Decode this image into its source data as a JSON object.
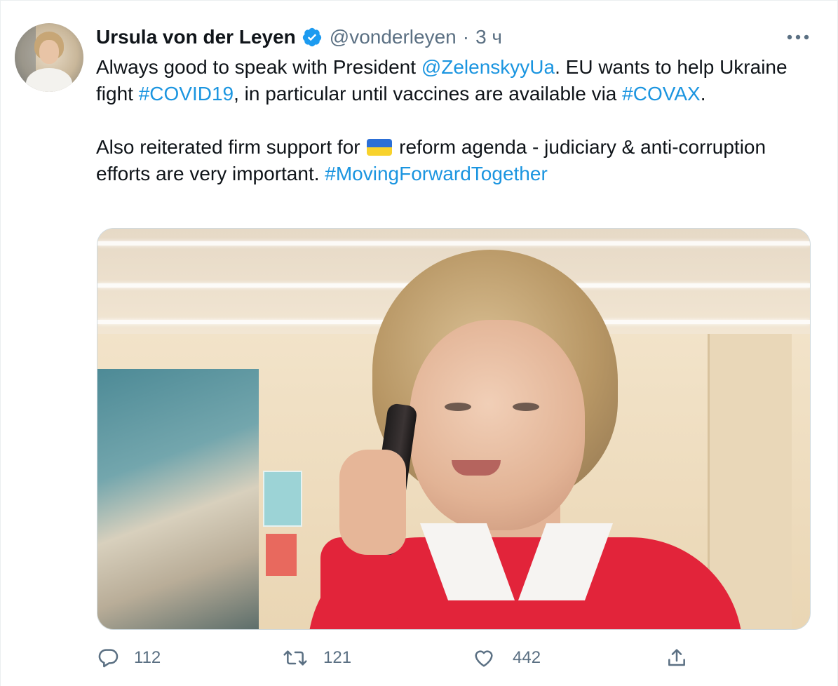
{
  "author": {
    "name": "Ursula von der Leyen",
    "handle": "@vonderleyen",
    "separator": "·",
    "time": "3 ч",
    "verified_icon": "verified-badge-icon"
  },
  "tweet": {
    "line1_a": "Always good to speak with President ",
    "mention": "@ZelenskyyUa",
    "line1_b": ". EU wants to help Ukraine fight ",
    "hashtag1": "#COVID19",
    "line1_c": ", in particular until vaccines are available via ",
    "hashtag2": "#COVAX",
    "line1_d": ".",
    "line2_a": "Also reiterated firm support for ",
    "flag_emoji": "🇺🇦",
    "line2_b": " reform agenda - judiciary & anti-corruption efforts are very important. ",
    "hashtag3": "#MovingForwardTogether"
  },
  "media": {
    "icon": "photo-media"
  },
  "actions": {
    "reply": {
      "icon": "reply-icon",
      "count": "112"
    },
    "retweet": {
      "icon": "retweet-icon",
      "count": "121"
    },
    "like": {
      "icon": "like-icon",
      "count": "442"
    },
    "share": {
      "icon": "share-icon"
    }
  },
  "colors": {
    "text": "#0f1419",
    "secondary": "#5b7083",
    "link": "#1b95e0",
    "verified": "#1d9bf0"
  }
}
